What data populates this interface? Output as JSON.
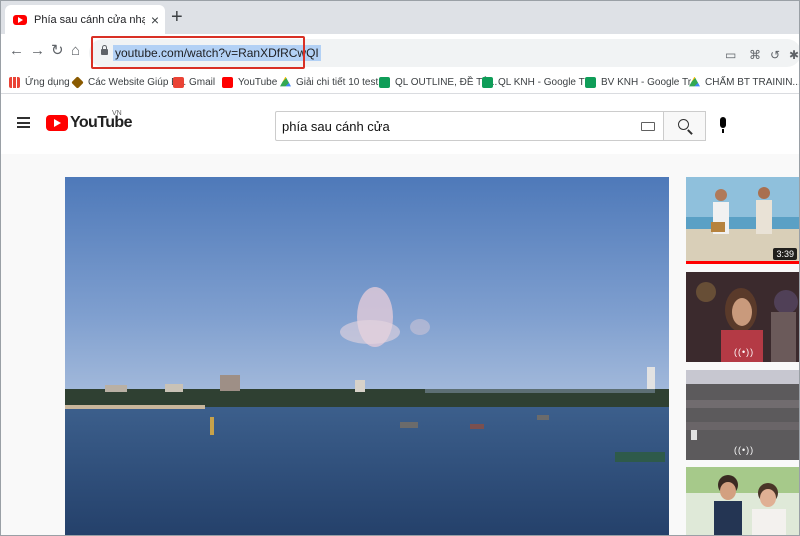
{
  "browser": {
    "tab": {
      "title": "Phía sau cánh cửa nhạc phim - Y"
    },
    "url": "youtube.com/watch?v=RanXDfRCwQI"
  },
  "bookmarks": [
    {
      "label": "Ứng dụng",
      "icon": "apps-icon"
    },
    {
      "label": "Các Website Giúp B...",
      "icon": "hexagon-icon"
    },
    {
      "label": "Gmail",
      "icon": "gmail-icon"
    },
    {
      "label": "YouTube",
      "icon": "youtube-icon"
    },
    {
      "label": "Giải chi tiết 10 test...",
      "icon": "drive-icon"
    },
    {
      "label": "QL OUTLINE, ĐỀ TÀ...",
      "icon": "sheets-icon"
    },
    {
      "label": "QL KNH - Google Tr...",
      "icon": "sheets-icon"
    },
    {
      "label": "BV KNH - Google Tr...",
      "icon": "sheets-icon"
    },
    {
      "label": "CHẤM BT TRAININ...",
      "icon": "drive-icon"
    }
  ],
  "youtube": {
    "logo_text": "YouTube",
    "region": "VN",
    "search_query": "phía sau cánh cửa"
  },
  "recommendations": [
    {
      "duration": "3:39",
      "watched_fraction": 1.0
    },
    {
      "badge": "((•))"
    },
    {
      "badge": "((•))"
    },
    {}
  ],
  "colors": {
    "youtube_red": "#ff0000",
    "highlight_box": "#d93025",
    "url_selection": "#b3d1f5"
  }
}
